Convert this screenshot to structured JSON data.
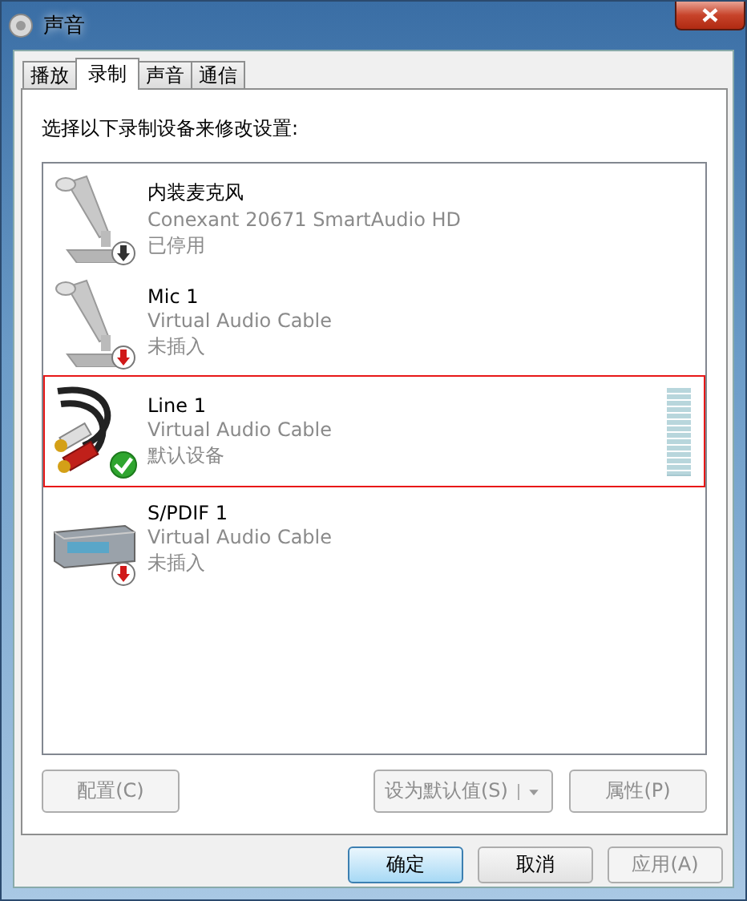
{
  "window": {
    "title": "声音"
  },
  "tabs": [
    {
      "label": "播放",
      "selected": false
    },
    {
      "label": "录制",
      "selected": true
    },
    {
      "label": "声音",
      "selected": false
    },
    {
      "label": "通信",
      "selected": false
    }
  ],
  "instruction": "选择以下录制设备来修改设置:",
  "devices": [
    {
      "name": "内装麦克风",
      "driver": "Conexant 20671 SmartAudio HD",
      "status": "已停用",
      "kind": "microphone",
      "badge": {
        "kind": "disabled"
      },
      "selected": false
    },
    {
      "name": "Mic 1",
      "driver": "Virtual Audio Cable",
      "status": "未插入",
      "kind": "microphone",
      "badge": {
        "kind": "unplugged"
      },
      "selected": false
    },
    {
      "name": "Line 1",
      "driver": "Virtual Audio Cable",
      "status": "默认设备",
      "kind": "cable",
      "badge": {
        "kind": "default"
      },
      "selected": true,
      "level": 0
    },
    {
      "name": "S/PDIF 1",
      "driver": "Virtual Audio Cable",
      "status": "未插入",
      "kind": "spdif",
      "badge": {
        "kind": "unplugged"
      },
      "selected": false
    }
  ],
  "panel_buttons": [
    {
      "label": "配置(C)",
      "disabled": true,
      "kind": "plain"
    },
    {
      "label": "设为默认值(S)",
      "disabled": true,
      "kind": "split"
    },
    {
      "label": "属性(P)",
      "disabled": true,
      "kind": "plain"
    }
  ],
  "dialog_buttons": [
    {
      "label": "确定",
      "disabled": false,
      "default": true
    },
    {
      "label": "取消",
      "disabled": false,
      "default": false
    },
    {
      "label": "应用(A)",
      "disabled": true,
      "default": false
    }
  ]
}
